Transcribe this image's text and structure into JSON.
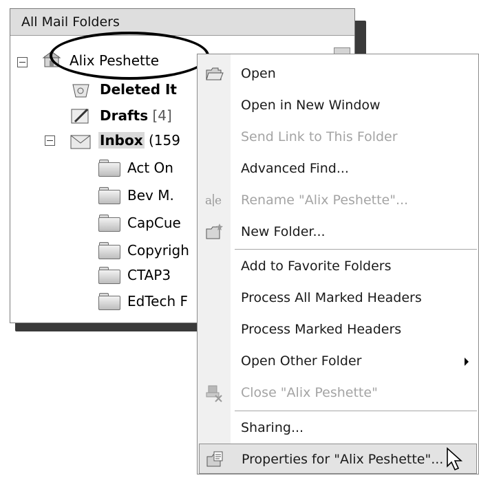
{
  "folder_pane": {
    "title": "All Mail Folders",
    "items": [
      {
        "label": "Alix Peshette",
        "count": ""
      },
      {
        "label": "Deleted It",
        "count": ""
      },
      {
        "label": "Drafts",
        "count": "[4]"
      },
      {
        "label": "Inbox",
        "count": "(159"
      },
      {
        "label": "Act On",
        "count": ""
      },
      {
        "label": "Bev M.",
        "count": ""
      },
      {
        "label": "CapCue",
        "count": ""
      },
      {
        "label": "Copyrigh",
        "count": ""
      },
      {
        "label": "CTAP3",
        "count": ""
      },
      {
        "label": "EdTech F",
        "count": ""
      }
    ]
  },
  "context_menu": {
    "items": [
      {
        "label": "Open",
        "icon": "open-folder-icon",
        "enabled": true
      },
      {
        "label": "Open in New Window",
        "enabled": true
      },
      {
        "label": "Send Link to This Folder",
        "enabled": false
      },
      {
        "label": "Advanced Find...",
        "enabled": true
      },
      {
        "label": "Rename \"Alix Peshette\"...",
        "icon": "rename-icon",
        "enabled": false
      },
      {
        "label": "New Folder...",
        "icon": "new-folder-icon",
        "enabled": true
      },
      {
        "label": "Add to Favorite Folders",
        "enabled": true
      },
      {
        "label": "Process All Marked Headers",
        "enabled": true
      },
      {
        "label": "Process Marked Headers",
        "enabled": true
      },
      {
        "label": "Open Other Folder",
        "enabled": true,
        "submenu": true
      },
      {
        "label": "Close \"Alix Peshette\"",
        "icon": "close-folder-icon",
        "enabled": false
      },
      {
        "label": "Sharing...",
        "enabled": true
      },
      {
        "label": "Properties for \"Alix Peshette\"...",
        "icon": "properties-icon",
        "enabled": true,
        "highlighted": true
      }
    ]
  },
  "colors": {
    "menu_background": "#ffffff",
    "gutter": "#f0f0f0",
    "disabled_text": "#a4a4a4",
    "highlight": "#e3e3e3",
    "header_background": "#dedede"
  }
}
